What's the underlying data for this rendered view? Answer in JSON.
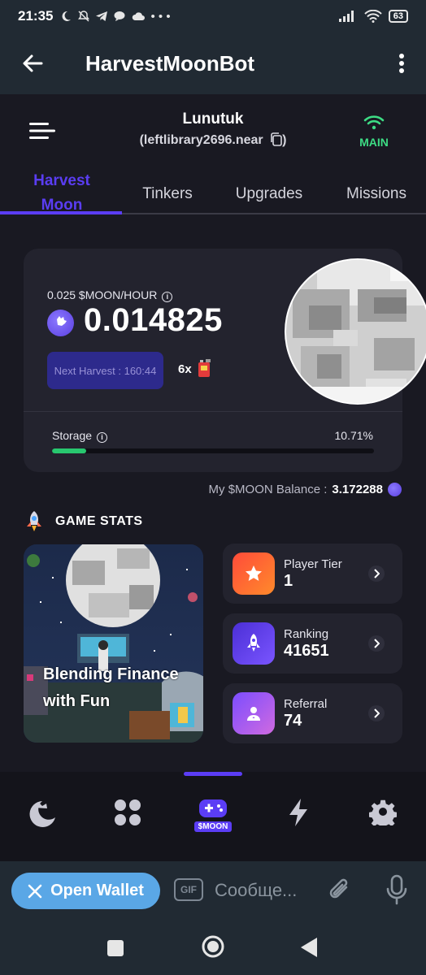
{
  "status_bar": {
    "time": "21:35",
    "battery": "63"
  },
  "header": {
    "title": "HarvestMoonBot"
  },
  "user": {
    "name": "Lunutuk",
    "account": "(leftlibrary2696.near",
    "account_end": ")"
  },
  "network": {
    "label": "MAIN"
  },
  "tabs": [
    {
      "label": "Harvest\nMoon",
      "line1": "Harvest",
      "line2": "Moon",
      "active": true
    },
    {
      "label": "Tinkers"
    },
    {
      "label": "Upgrades"
    },
    {
      "label": "Missions"
    }
  ],
  "harvest": {
    "rate": "0.025 $MOON/HOUR",
    "amount": "0.014825",
    "next_harvest": "Next Harvest : 160:44",
    "multiplier": "6x",
    "storage_label": "Storage",
    "storage_pct": "10.71%",
    "storage_fraction": 0.1071
  },
  "balance": {
    "label": "My $MOON Balance :",
    "value": "3.172288"
  },
  "game_stats": {
    "title": "GAME STATS",
    "caption": "Blending Finance with Fun",
    "stats": [
      {
        "label": "Player Tier",
        "value": "1",
        "icon": "star-icon",
        "color_from": "#ff5a36",
        "color_to": "#ff8a2b"
      },
      {
        "label": "Ranking",
        "value": "41651",
        "icon": "rocket-icon",
        "color_from": "#4b2fd6",
        "color_to": "#7a55ff"
      },
      {
        "label": "Referral",
        "value": "74",
        "icon": "person-icon",
        "color_from": "#7b4dff",
        "color_to": "#c86be8"
      }
    ]
  },
  "bottom_nav": {
    "items": [
      {
        "icon": "moon-icon"
      },
      {
        "icon": "grid-icon"
      },
      {
        "icon": "gamepad-icon",
        "badge": "$MOON",
        "active": true
      },
      {
        "icon": "bolt-icon"
      },
      {
        "icon": "gear-icon"
      }
    ]
  },
  "telegram_input": {
    "open_wallet": "Open Wallet",
    "gif": "GIF",
    "placeholder": "Сообще..."
  },
  "colors": {
    "accent": "#5b3df5",
    "storage_fill": "#28c76f",
    "wallet_button": "#5aa7e6",
    "network": "#3ddc84"
  }
}
